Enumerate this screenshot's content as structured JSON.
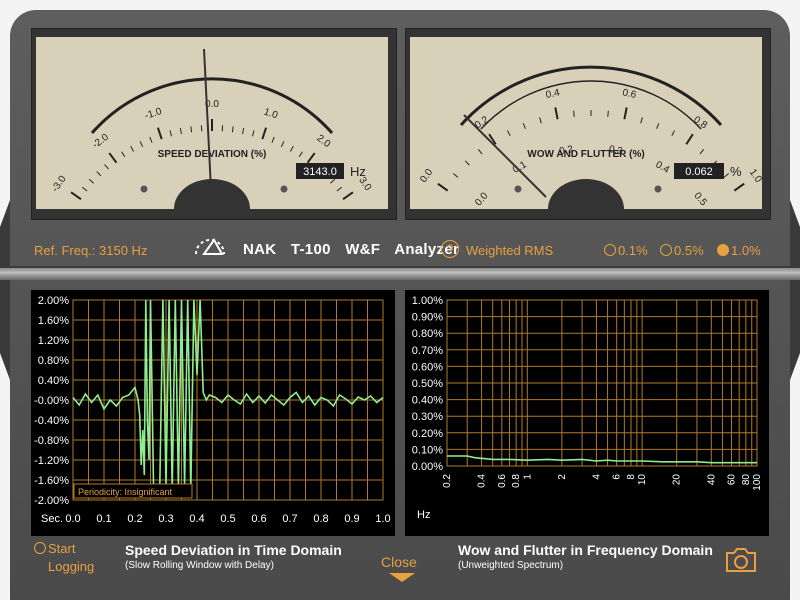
{
  "meter_left": {
    "scale_labels": [
      "-3.0",
      "-2.0",
      "-1.0",
      "0.0",
      "1.0",
      "2.0",
      "3.0"
    ],
    "label": "SPEED DEVIATION (%)",
    "value": "3143.0",
    "unit": "Hz"
  },
  "meter_right": {
    "outer_labels": [
      "0.0",
      "0.2",
      "0.4",
      "0.6",
      "0.8",
      "1.0"
    ],
    "inner_labels": [
      "0.0",
      "0.1",
      "0.2",
      "0.3",
      "0.4",
      "0.5"
    ],
    "label": "WOW AND FLUTTER (%)",
    "value": "0.062",
    "unit": "%"
  },
  "toolbar": {
    "ref_freq": "Ref. Freq.: 3150 Hz",
    "brand": "NAK",
    "model": "T-100",
    "wf": "W&F",
    "analyzer": "Analyzer",
    "help": "?",
    "weighted": "Weighted RMS",
    "range_options": [
      "0.1%",
      "0.5%",
      "1.0%"
    ],
    "selected_range": "1.0%"
  },
  "time_chart": {
    "title": "Speed Deviation in Time Domain",
    "subtitle": "(Slow Rolling Window with Delay)",
    "periodicity": "Periodicity: Insignificant",
    "x_unit": "Sec."
  },
  "freq_chart": {
    "title": "Wow and Flutter in Frequency Domain",
    "subtitle": "(Unweighted Spectrum)",
    "x_unit": "Hz"
  },
  "bottom": {
    "logging_line1": "Start",
    "logging_line2": "Logging",
    "close": "Close"
  },
  "chart_data": [
    {
      "type": "line",
      "title": "Speed Deviation in Time Domain",
      "xlabel": "Sec.",
      "xlim": [
        0,
        1.0
      ],
      "ylim": [
        -2.0,
        2.0
      ],
      "x_ticks": [
        "0.0",
        "0.1",
        "0.2",
        "0.3",
        "0.4",
        "0.5",
        "0.6",
        "0.7",
        "0.8",
        "0.9",
        "1.0"
      ],
      "y_ticks": [
        "2.00%",
        "1.60%",
        "1.20%",
        "0.80%",
        "0.40%",
        "-0.00%",
        "-0.40%",
        "-0.80%",
        "-1.20%",
        "-1.60%",
        "-2.00%"
      ],
      "series": [
        {
          "color": "#90ee90",
          "x": [
            0.0,
            0.02,
            0.04,
            0.06,
            0.08,
            0.1,
            0.12,
            0.14,
            0.16,
            0.18,
            0.2,
            0.21,
            0.215,
            0.22,
            0.225,
            0.23,
            0.235,
            0.24,
            0.245,
            0.25,
            0.255,
            0.26,
            0.28,
            0.29,
            0.3,
            0.31,
            0.32,
            0.33,
            0.34,
            0.35,
            0.36,
            0.37,
            0.38,
            0.39,
            0.4,
            0.41,
            0.42,
            0.43,
            0.44,
            0.46,
            0.48,
            0.5,
            0.52,
            0.54,
            0.56,
            0.58,
            0.6,
            0.62,
            0.64,
            0.66,
            0.68,
            0.7,
            0.72,
            0.74,
            0.76,
            0.78,
            0.8,
            0.82,
            0.84,
            0.86,
            0.88,
            0.9,
            0.92,
            0.94,
            0.96,
            0.98,
            1.0
          ],
          "y": [
            0.05,
            -0.1,
            0.12,
            -0.05,
            0.1,
            -0.18,
            0.0,
            -0.12,
            0.05,
            0.1,
            0.25,
            0.0,
            -0.3,
            -1.3,
            -0.6,
            -1.5,
            2.0,
            -0.4,
            -1.2,
            2.0,
            0.2,
            -1.8,
            -1.7,
            2.0,
            -1.7,
            2.0,
            -1.8,
            2.0,
            -1.75,
            2.0,
            -1.7,
            2.0,
            -1.8,
            2.0,
            0.5,
            2.0,
            0.15,
            0.0,
            0.1,
            0.05,
            -0.05,
            0.1,
            0.0,
            -0.08,
            0.12,
            -0.05,
            0.08,
            -0.06,
            0.1,
            0.0,
            -0.1,
            0.05,
            0.15,
            -0.05,
            0.08,
            -0.1,
            0.05,
            0.0,
            -0.12,
            0.1,
            0.02,
            -0.08,
            0.06,
            0.0,
            0.08,
            -0.05,
            0.05
          ]
        }
      ]
    },
    {
      "type": "line",
      "title": "Wow and Flutter in Frequency Domain",
      "xlabel": "Hz",
      "xlim": [
        0.2,
        100
      ],
      "x_scale": "log",
      "ylim": [
        0,
        1.0
      ],
      "x_ticks": [
        "0.2",
        "0.4",
        "0.6",
        "0.8",
        "1",
        "2",
        "4",
        "6",
        "8",
        "10",
        "20",
        "40",
        "60",
        "80",
        "100"
      ],
      "y_ticks": [
        "1.00%",
        "0.90%",
        "0.80%",
        "0.70%",
        "0.60%",
        "0.50%",
        "0.40%",
        "0.30%",
        "0.20%",
        "0.10%",
        "0.00%"
      ],
      "series": [
        {
          "color": "#90ee90",
          "x": [
            0.2,
            0.3,
            0.35,
            0.5,
            0.7,
            1,
            1.5,
            2,
            3,
            4,
            5,
            6,
            8,
            10,
            15,
            20,
            30,
            40,
            60,
            80,
            100
          ],
          "y": [
            0.06,
            0.06,
            0.05,
            0.04,
            0.04,
            0.035,
            0.04,
            0.035,
            0.04,
            0.03,
            0.035,
            0.03,
            0.03,
            0.03,
            0.025,
            0.025,
            0.025,
            0.02,
            0.02,
            0.02,
            0.02
          ]
        }
      ]
    }
  ]
}
